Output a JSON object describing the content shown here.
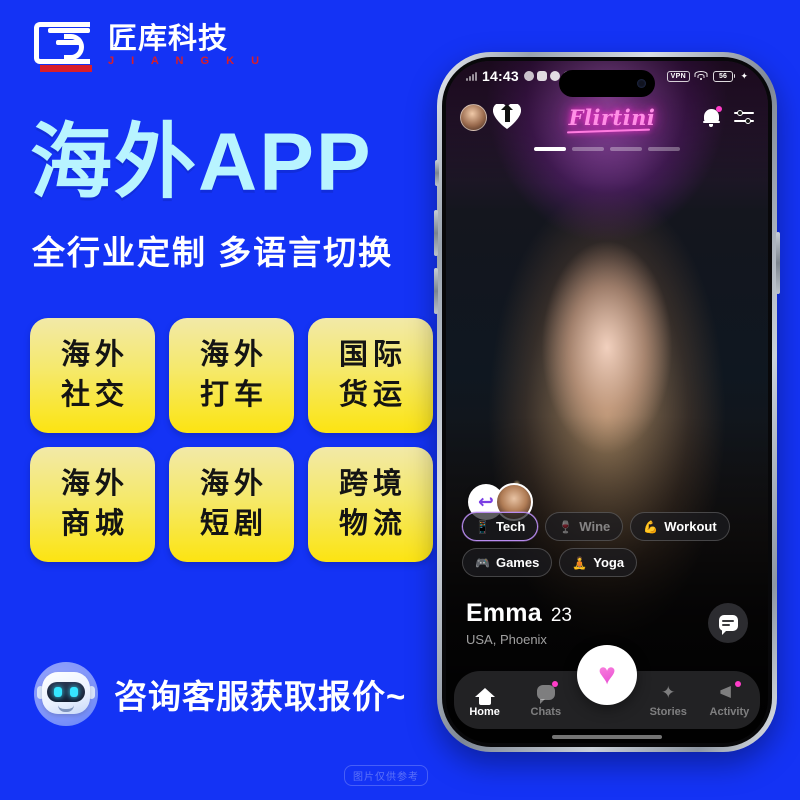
{
  "brand": {
    "logo_icon": "jiangku-logo-mark",
    "name_cn": "匠库科技",
    "name_en": "J I A N G K U"
  },
  "promo": {
    "headline": "海外APP",
    "subline": "全行业定制 多语言切换",
    "tags": [
      {
        "line1": "海外",
        "line2": "社交"
      },
      {
        "line1": "海外",
        "line2": "打车"
      },
      {
        "line1": "国际",
        "line2": "货运"
      },
      {
        "line1": "海外",
        "line2": "商城"
      },
      {
        "line1": "海外",
        "line2": "短剧"
      },
      {
        "line1": "跨境",
        "line2": "物流"
      }
    ],
    "cta_text": "咨询客服获取报价~",
    "cta_icon": "robot-assistant-icon",
    "watermark": "图片仅供参考",
    "colors": {
      "background": "#1433F5",
      "headline": "#B8F4FF",
      "tag_yellow": "#FCE411",
      "accent_red": "#D81E2A"
    }
  },
  "phone": {
    "status_bar": {
      "time": "14:43",
      "signal_icon": "signal-bars-icon",
      "app_icons": [
        "notification-icon-1",
        "notification-icon-2",
        "notification-icon-3",
        "notification-icon-4",
        "notification-icon-5"
      ],
      "vpn_label": "VPN",
      "wifi_icon": "wifi-icon",
      "battery_level": "56",
      "charging_icon": "bolt-icon"
    },
    "app_header": {
      "avatar_icon": "user-avatar",
      "boost_icon": "heart-boost-icon",
      "logo_text": "Flirtini",
      "bell_icon": "notification-bell-icon",
      "bell_has_badge": true,
      "filter_icon": "sliders-filter-icon"
    },
    "story_segments": {
      "total": 4,
      "active_index": 0
    },
    "rewind": {
      "icon": "rewind-arrow-icon",
      "thumb_icon": "previous-profile-thumb"
    },
    "chips": [
      {
        "label": "Tech",
        "glyph": "📱",
        "selected": true,
        "dim": false
      },
      {
        "label": "Wine",
        "glyph": "🍷",
        "selected": false,
        "dim": true
      },
      {
        "label": "Workout",
        "glyph": "💪",
        "selected": false,
        "dim": false
      },
      {
        "label": "Games",
        "glyph": "🎮",
        "selected": false,
        "dim": false
      },
      {
        "label": "Yoga",
        "glyph": "🧘",
        "selected": false,
        "dim": false
      }
    ],
    "profile": {
      "name": "Emma",
      "age": "23",
      "location": "USA, Phoenix",
      "message_icon": "message-bubble-icon"
    },
    "nav": {
      "items": [
        {
          "label": "Home",
          "icon": "home-icon",
          "active": true,
          "badge": false
        },
        {
          "label": "Chats",
          "icon": "chat-icon",
          "active": false,
          "badge": true
        },
        {
          "label": "Stories",
          "icon": "sparkles-icon",
          "active": false,
          "badge": false
        },
        {
          "label": "Activity",
          "icon": "megaphone-icon",
          "active": false,
          "badge": true
        }
      ],
      "fab_icon": "heart-like-icon",
      "accent_pink": "#FF3DC8"
    }
  }
}
